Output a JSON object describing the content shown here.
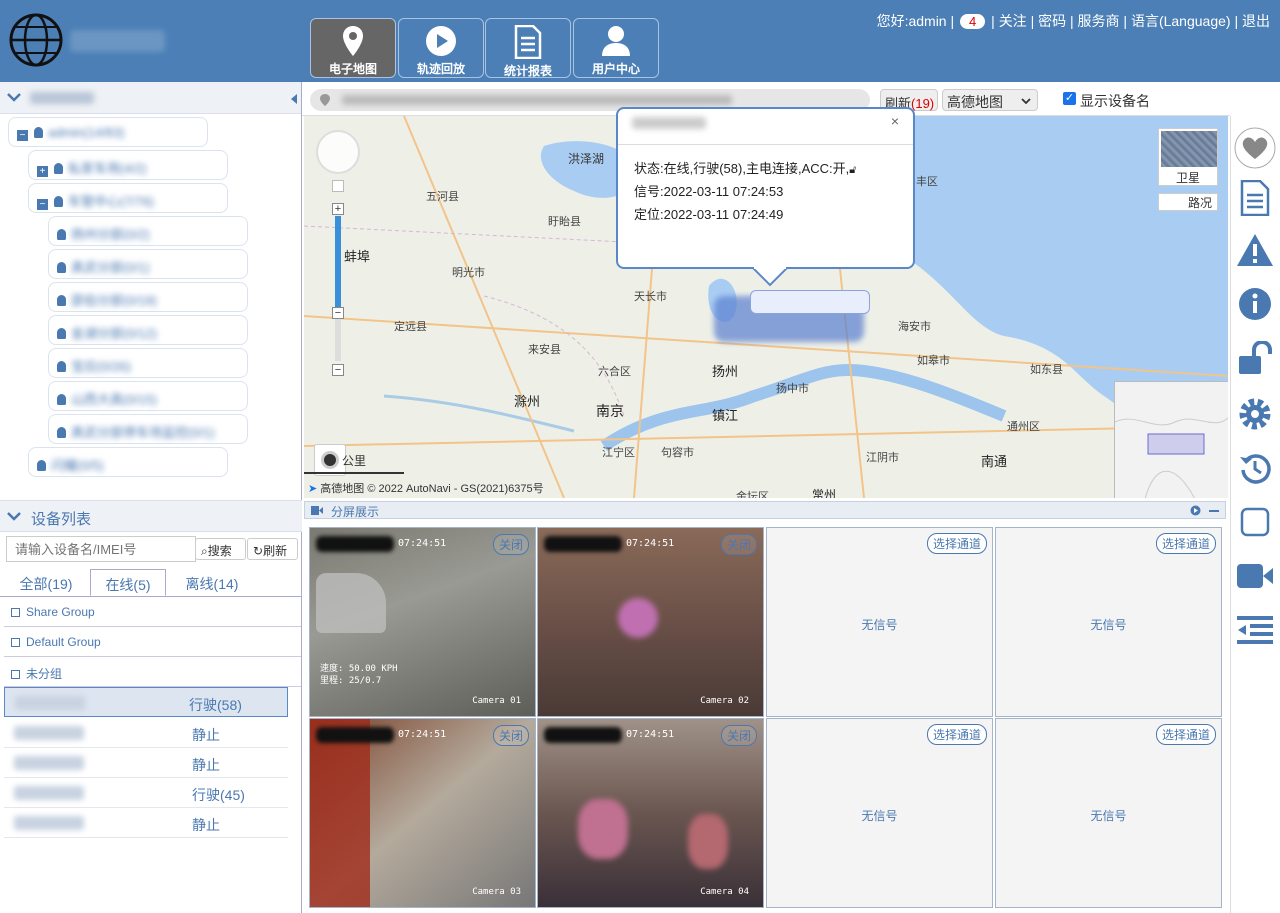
{
  "header": {
    "nav": [
      {
        "label": "电子地图",
        "icon": "map-pin-icon"
      },
      {
        "label": "轨迹回放",
        "icon": "play-icon"
      },
      {
        "label": "统计报表",
        "icon": "report-icon"
      },
      {
        "label": "用户中心",
        "icon": "user-icon"
      }
    ],
    "greeting": "您好:admin",
    "sep": "|",
    "alert_count": "4",
    "links": [
      "关注",
      "密码",
      "服务商",
      "语言(Language)",
      "退出"
    ]
  },
  "tree": {
    "items": [
      {
        "label": "admin(14/83)",
        "level": 0
      },
      {
        "label": "私家车用(4/2)",
        "level": 1
      },
      {
        "label": "车管中心(7/76)",
        "level": 1
      },
      {
        "label": "扬州分部(0/2)",
        "level": 2
      },
      {
        "label": "真武分部(0/1)",
        "level": 2
      },
      {
        "label": "邵伯分部(0/19)",
        "level": 2
      },
      {
        "label": "金湖分部(0/12)",
        "level": 2
      },
      {
        "label": "宝应(0/26)",
        "level": 2
      },
      {
        "label": "山西大高(0/15)",
        "level": 2
      },
      {
        "label": "真武分部停车场监控(0/1)",
        "level": 2
      },
      {
        "label": "闪耀(0/5)",
        "level": 1
      }
    ]
  },
  "devices": {
    "title": "设备列表",
    "search_placeholder": "请输入设备名/IMEI号",
    "search_btn": "搜索",
    "refresh_btn": "刷新",
    "tabs": [
      "全部(19)",
      "在线(5)",
      "离线(14)"
    ],
    "groups": [
      "Share Group",
      "Default Group",
      "未分组"
    ],
    "rows": [
      {
        "status": "行驶(58)"
      },
      {
        "status": "静止"
      },
      {
        "status": "静止"
      },
      {
        "status": "行驶(45)"
      },
      {
        "status": "静止"
      }
    ]
  },
  "map": {
    "refresh_label": "刷新",
    "refresh_count": "(19)",
    "map_type": "高德地图",
    "show_name_label": "显示设备名",
    "satellite": "卫星",
    "traffic": "路况",
    "copyright": "© 2022 AutoNavi - GS(2021)6375号",
    "logo": "高德地图",
    "scale": "公里",
    "labels": [
      {
        "t": "洪泽湖",
        "c": false
      },
      {
        "t": "五河县",
        "c": false
      },
      {
        "t": "盱眙县",
        "c": false
      },
      {
        "t": "蚌埠",
        "c": true
      },
      {
        "t": "明光市",
        "c": false
      },
      {
        "t": "天长市",
        "c": false
      },
      {
        "t": "定远县",
        "c": false
      },
      {
        "t": "来安县",
        "c": false
      },
      {
        "t": "六合区",
        "c": false
      },
      {
        "t": "扬州",
        "c": true
      },
      {
        "t": "扬中市",
        "c": false
      },
      {
        "t": "滁州",
        "c": true
      },
      {
        "t": "南京",
        "c": true
      },
      {
        "t": "镇江",
        "c": true
      },
      {
        "t": "江宁区",
        "c": false
      },
      {
        "t": "句容市",
        "c": false
      },
      {
        "t": "江阴市",
        "c": false
      },
      {
        "t": "南通",
        "c": true
      },
      {
        "t": "通州区",
        "c": false
      },
      {
        "t": "海安市",
        "c": false
      },
      {
        "t": "如皋市",
        "c": false
      },
      {
        "t": "如东县",
        "c": false
      },
      {
        "t": "丰区",
        "c": false
      },
      {
        "t": "常州",
        "c": true
      },
      {
        "t": "金坛区",
        "c": false
      }
    ]
  },
  "popup": {
    "status": "状态:在线,行驶(58),主电连接,ACC:开,",
    "signal": "信号:2022-03-11 07:24:53",
    "locate": "定位:2022-03-11 07:24:49"
  },
  "split": {
    "title": "分屏展示",
    "close": "关闭",
    "choose": "选择通道",
    "nosignal": "无信号",
    "timestamp": "07:24:51",
    "osd": "速度: 50.00 KPH",
    "osd2": "里程: 25/0.7",
    "cameras": [
      "Camera 01",
      "Camera 02",
      "Camera 03",
      "Camera 04"
    ]
  },
  "colors": {
    "header": "#4b7fb6",
    "accent": "#4a78b0",
    "danger": "#d00000"
  }
}
